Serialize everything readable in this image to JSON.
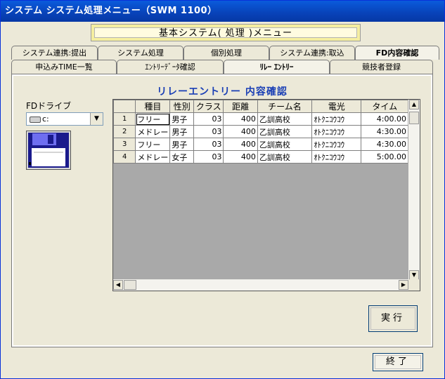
{
  "window": {
    "title": "システム システム処理メニュー（SWM 1100）"
  },
  "banner": {
    "text": "基本システム( 処理 )メニュー"
  },
  "tabs_back": [
    {
      "label": "システム連携:提出",
      "active": false
    },
    {
      "label": "システム処理",
      "active": false
    },
    {
      "label": "個別処理",
      "active": false
    },
    {
      "label": "システム連携:取込",
      "active": false
    },
    {
      "label": "FD内容確認",
      "active": true
    }
  ],
  "tabs_front": [
    {
      "label": "申込みTIME一覧",
      "active": false
    },
    {
      "label": "ｴﾝﾄﾘｰﾃﾞｰﾀ確認",
      "active": false
    },
    {
      "label": "ﾘﾚｰ ｴﾝﾄﾘｰ",
      "active": true
    },
    {
      "label": "競技者登録",
      "active": false
    }
  ],
  "panel": {
    "title": "リレーエントリー 内容確認"
  },
  "fd": {
    "label": "FDドライブ",
    "drive": "c:",
    "drive_icon": "drive-icon",
    "floppy_icon": "floppy-disk-icon"
  },
  "table": {
    "headers": [
      "",
      "種目",
      "性別",
      "クラス",
      "距離",
      "チーム名",
      "電光",
      "タイム"
    ],
    "rows": [
      [
        "1",
        "フリー",
        "男子",
        "03",
        "400",
        "乙訓高校",
        "ｵﾄｸﾆｺｳｺｳ",
        "4:00.00"
      ],
      [
        "2",
        "メドレー",
        "男子",
        "03",
        "400",
        "乙訓高校",
        "ｵﾄｸﾆｺｳｺｳ",
        "4:30.00"
      ],
      [
        "3",
        "フリー",
        "男子",
        "03",
        "400",
        "乙訓高校",
        "ｵﾄｸﾆｺｳｺｳ",
        "4:30.00"
      ],
      [
        "4",
        "メドレー",
        "女子",
        "03",
        "400",
        "乙訓高校",
        "ｵﾄｸﾆｺｳｺｳ",
        "5:00.00"
      ]
    ]
  },
  "buttons": {
    "execute": "実行",
    "exit": "終了"
  }
}
